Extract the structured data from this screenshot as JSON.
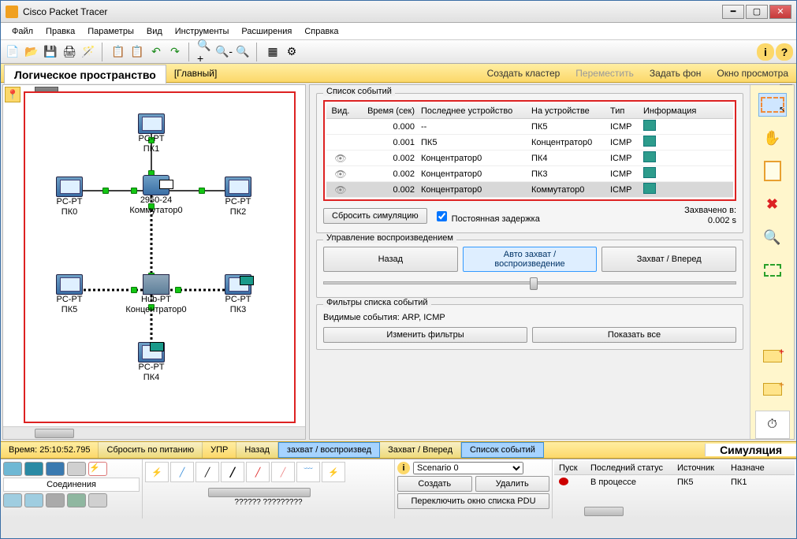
{
  "window_title": "Cisco Packet Tracer",
  "menu": [
    "Файл",
    "Правка",
    "Параметры",
    "Вид",
    "Инструменты",
    "Расширения",
    "Справка"
  ],
  "yellowbar": {
    "workspace": "Логическое пространство",
    "main_label": "[Главный]",
    "create_cluster": "Создать кластер",
    "move": "Переместить",
    "set_bg": "Задать фон",
    "viewport": "Окно просмотра"
  },
  "devices": {
    "pk0": {
      "type": "PC-PT",
      "name": "ПК0"
    },
    "pk1": {
      "type": "PC-PT",
      "name": "ПК1"
    },
    "pk2": {
      "type": "PC-PT",
      "name": "ПК2"
    },
    "pk3": {
      "type": "PC-PT",
      "name": "ПК3"
    },
    "pk4": {
      "type": "PC-PT",
      "name": "ПК4"
    },
    "pk5": {
      "type": "PC-PT",
      "name": "ПК5"
    },
    "sw": {
      "type": "2950-24",
      "name": "Коммутатор0"
    },
    "hub": {
      "type": "Hub-PT",
      "name": "Концентратор0"
    }
  },
  "events": {
    "title": "Список событий",
    "columns": [
      "Вид.",
      "Время (сек)",
      "Последнее устройство",
      "На устройстве",
      "Тип",
      "Информация"
    ],
    "rows": [
      {
        "vid": "",
        "time": "0.000",
        "last": "--",
        "at": "ПК5",
        "type": "ICMP"
      },
      {
        "vid": "",
        "time": "0.001",
        "last": "ПК5",
        "at": "Концентратор0",
        "type": "ICMP"
      },
      {
        "vid": "eye",
        "time": "0.002",
        "last": "Концентратор0",
        "at": "ПК4",
        "type": "ICMP"
      },
      {
        "vid": "eye",
        "time": "0.002",
        "last": "Концентратор0",
        "at": "ПК3",
        "type": "ICMP"
      },
      {
        "vid": "eye",
        "time": "0.002",
        "last": "Концентратор0",
        "at": "Коммутатор0",
        "type": "ICMP",
        "selected": true
      }
    ]
  },
  "captured": {
    "label": "Захвачено в:",
    "value": "0.002 s"
  },
  "reset_sim": "Сбросить симуляцию",
  "const_delay": "Постоянная задержка",
  "playback": {
    "title": "Управление воспроизведением",
    "back": "Назад",
    "auto": "Авто захват / воспроизведение",
    "fwd": "Захват / Вперед"
  },
  "filters": {
    "title": "Фильтры списка событий",
    "visible": "Видимые события: ARP, ICMP",
    "edit": "Изменить фильтры",
    "showall": "Показать все"
  },
  "footer": {
    "time": "Время: 25:10:52.795",
    "reset_power": "Сбросить по питанию",
    "upr": "УПР",
    "back": "Назад",
    "capplay": "захват / воспроизвед",
    "capfwd": "Захват / Вперед",
    "eventlist": "Список событий",
    "sim": "Симуляция"
  },
  "palette": {
    "name": "Соединения",
    "unknown": "?????? ?????????"
  },
  "scenario": {
    "name": "Scenario 0",
    "create": "Создать",
    "del": "Удалить",
    "switch": "Переключить окно списка PDU"
  },
  "pdu": {
    "cols": [
      "Пуск",
      "Последний статус",
      "Источник",
      "Назначе"
    ],
    "row": {
      "status": "В процессе",
      "src": "ПК5",
      "dst": "ПК1"
    }
  }
}
